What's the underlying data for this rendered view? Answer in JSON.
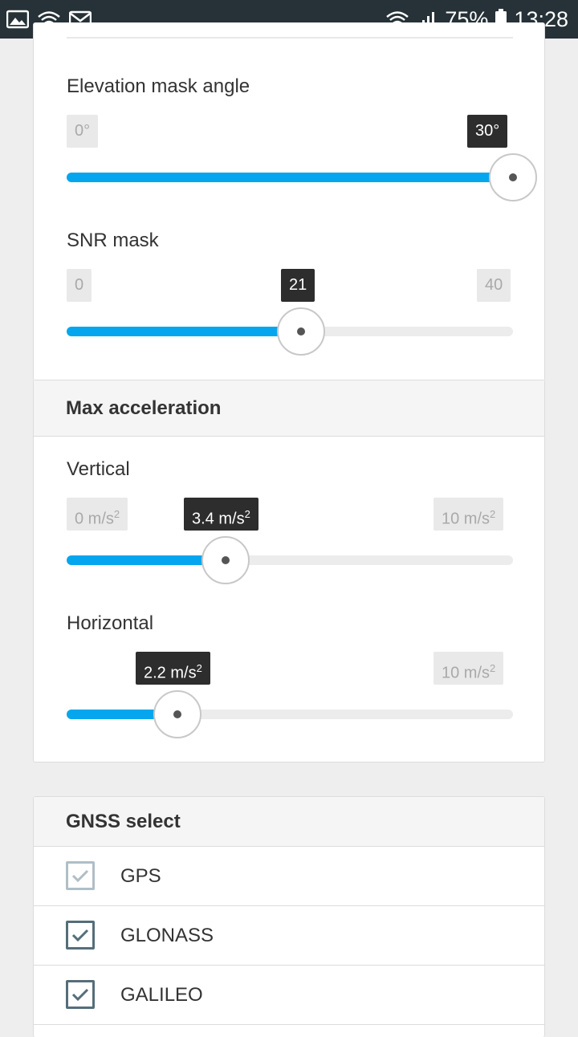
{
  "status_bar": {
    "dots": "...",
    "battery": "75%",
    "time": "13:28",
    "icons": [
      "image-icon",
      "wifi-icon",
      "mail-icon",
      "wifi-icon",
      "signal-icon",
      "battery-icon"
    ]
  },
  "elevation": {
    "label": "Elevation mask angle",
    "min": "0°",
    "value": "30°",
    "fraction": 1.0
  },
  "snr": {
    "label": "SNR mask",
    "min": "0",
    "max": "40",
    "value": "21",
    "fraction": 0.525
  },
  "max_acceleration": {
    "title": "Max acceleration",
    "vertical": {
      "label": "Vertical",
      "min": "0 m/s",
      "max": "10 m/s",
      "value": "3.4 m/s",
      "exp": "2",
      "fraction": 0.34
    },
    "horizontal": {
      "label": "Horizontal",
      "max": "10 m/s",
      "value": "2.2 m/s",
      "exp": "2",
      "fraction": 0.22
    }
  },
  "gnss": {
    "title": "GNSS select",
    "items": [
      {
        "label": "GPS",
        "checked": true,
        "disabled": true
      },
      {
        "label": "GLONASS",
        "checked": true,
        "disabled": false
      },
      {
        "label": "GALILEO",
        "checked": true,
        "disabled": false
      }
    ]
  },
  "colors": {
    "accent": "#05a6ee",
    "statusbar": "#263238",
    "value_chip": "#2d2d2d"
  }
}
